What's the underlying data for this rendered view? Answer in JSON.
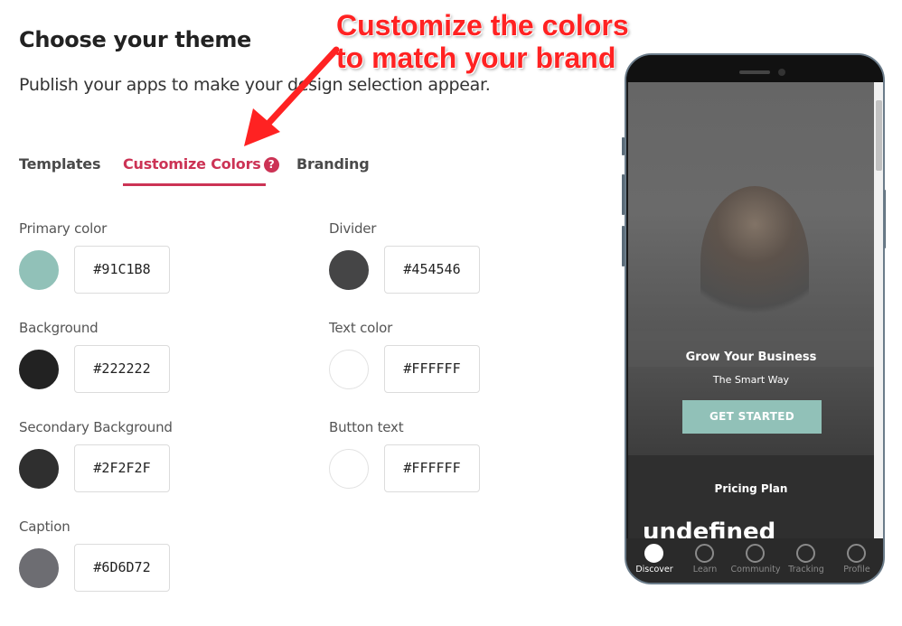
{
  "page": {
    "title": "Choose your theme",
    "subtitle": "Publish your apps to make your design selection appear."
  },
  "tabs": [
    {
      "label": "Templates",
      "active": false
    },
    {
      "label": "Customize Colors",
      "active": true
    },
    {
      "label": "Branding",
      "active": false
    }
  ],
  "help_icon": "?",
  "colors": {
    "primary": {
      "label": "Primary color",
      "value": "#91C1B8"
    },
    "divider": {
      "label": "Divider",
      "value": "#454546"
    },
    "background": {
      "label": "Background",
      "value": "#222222"
    },
    "text": {
      "label": "Text color",
      "value": "#FFFFFF"
    },
    "secondary_background": {
      "label": "Secondary Background",
      "value": "#2F2F2F"
    },
    "button_text": {
      "label": "Button text",
      "value": "#FFFFFF"
    },
    "caption": {
      "label": "Caption",
      "value": "#6D6D72"
    }
  },
  "annotation": {
    "line1": "Customize the colors",
    "line2": "to match your brand",
    "color": "#ff2222"
  },
  "preview": {
    "hero_title": "Grow Your Business",
    "hero_subtitle": "The Smart Way",
    "cta_label": "GET STARTED",
    "pricing_title": "Pricing Plan",
    "pricing_value": "undefined",
    "nav": [
      {
        "label": "Discover",
        "icon": "compass-icon",
        "active": true
      },
      {
        "label": "Learn",
        "icon": "learn-icon",
        "active": false
      },
      {
        "label": "Community",
        "icon": "chat-bubble-icon",
        "active": false
      },
      {
        "label": "Tracking",
        "icon": "chart-line-icon",
        "active": false
      },
      {
        "label": "Profile",
        "icon": "person-icon",
        "active": false
      }
    ]
  },
  "accent": "#cc3355"
}
